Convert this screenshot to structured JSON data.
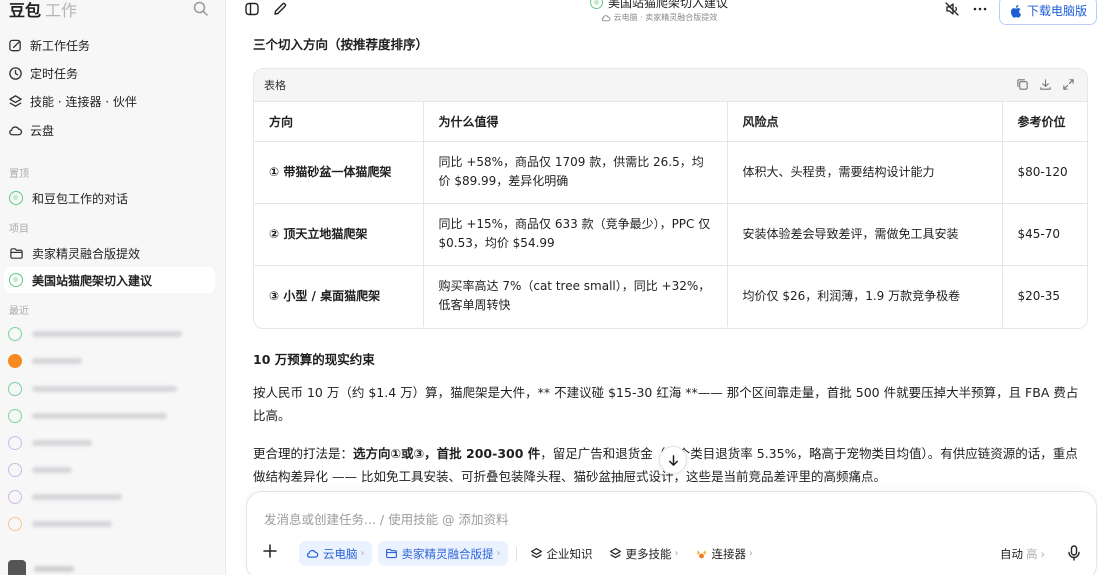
{
  "sidebar": {
    "brand": "豆包",
    "brand_sub": "工作",
    "nav": [
      {
        "label": "新工作任务"
      },
      {
        "label": "定时任务"
      },
      {
        "label": "技能 · 连接器 · 伙伴"
      },
      {
        "label": "云盘"
      }
    ],
    "pinned_label": "置顶",
    "pinned": [
      {
        "label": "和豆包工作的对话"
      }
    ],
    "projects_label": "项目",
    "projects": [
      {
        "label": "卖家精灵融合版提效"
      },
      {
        "label": "美国站猫爬架切入建议"
      }
    ],
    "recent_label": "最近"
  },
  "topbar": {
    "title": "美国站猫爬架切入建议",
    "subtitle": "云电脑 · 卖家精灵融合版提效",
    "download_label": "下载电脑版"
  },
  "content": {
    "heading": "三个切入方向（按推荐度排序）",
    "table": {
      "label": "表格",
      "headers": [
        "方向",
        "为什么值得",
        "风险点",
        "参考价位"
      ],
      "rows": [
        [
          "① 带猫砂盆一体猫爬架",
          "同比 +58%，商品仅 1709 款，供需比 26.5，均价 $89.99，差异化明确",
          "体积大、头程贵，需要结构设计能力",
          "$80-120"
        ],
        [
          "② 顶天立地猫爬架",
          "同比 +15%，商品仅 633 款（竞争最少），PPC 仅 $0.53，均价 $54.99",
          "安装体验差会导致差评，需做免工具安装",
          "$45-70"
        ],
        [
          "③ 小型 / 桌面猫爬架",
          "购买率高达 7%（cat tree small），同比 +32%，低客单周转快",
          "均价仅 $26，利润薄，1.9 万款竞争极卷",
          "$20-35"
        ]
      ]
    },
    "section2_title": "10 万预算的现实约束",
    "para1": "按人民币 10 万（约 $1.4 万）算，猫爬架是大件，** 不建议碰 $15-30 红海 **—— 那个区间靠走量，首批 500 件就要压掉大半预算，且 FBA 费占比高。",
    "para2_prefix": "更合理的打法是：",
    "para2_bold": "选方向①或③，首批 200-300 件",
    "para2_rest": "，留足广告和退货金（这个类目退货率 5.35%，略高于宠物类目均值）。有供应链资源的话，重点做结构差异化 —— 比如免工具安装、可折叠包装降头程、猫砂盆抽屉式设计，这些是当前竞品差评里的高频痛点。"
  },
  "composer": {
    "placeholder": "发消息或创建任务... / 使用技能 @ 添加资料",
    "chips": [
      {
        "label": "云电脑"
      },
      {
        "label": "卖家精灵融合版提"
      },
      {
        "label": "企业知识"
      },
      {
        "label": "更多技能"
      },
      {
        "label": "连接器"
      }
    ],
    "mode": "自动",
    "mode_level": "高"
  }
}
